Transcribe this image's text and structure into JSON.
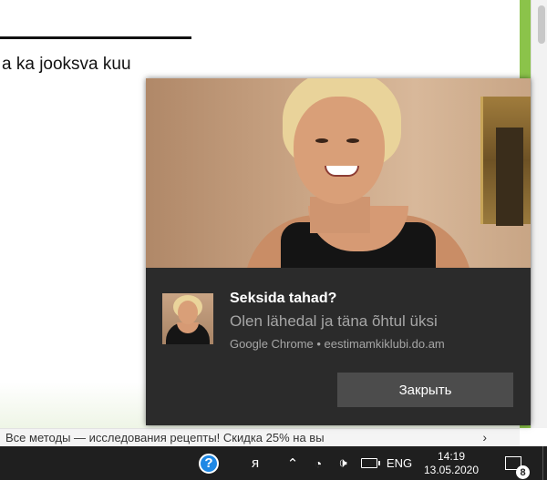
{
  "page": {
    "text": "a ka jooksva kuu",
    "bottom_banner": "Все методы — исследования рецепты! Скидка 25% на вы",
    "bottom_chevron": "›"
  },
  "toast": {
    "title": "Seksida tahad?",
    "body": "Olen lähedal ja täna õhtul üksi",
    "source": "Google Chrome • eestimamkiklubi.do.am",
    "button": "Закрыть"
  },
  "taskbar": {
    "help_icon": "?",
    "people_icon": "ᴙ",
    "chevron_icon": "⌃",
    "wifi_icon": "◔",
    "volume_icon": "🕩",
    "language": "ENG",
    "time": "14:19",
    "date": "13.05.2020",
    "notification_count": "8"
  },
  "colors": {
    "accent_green": "#8bc34a",
    "toast_bg": "#2b2b2b",
    "taskbar_bg": "#1f1f1f",
    "help_blue": "#1e88e5"
  }
}
